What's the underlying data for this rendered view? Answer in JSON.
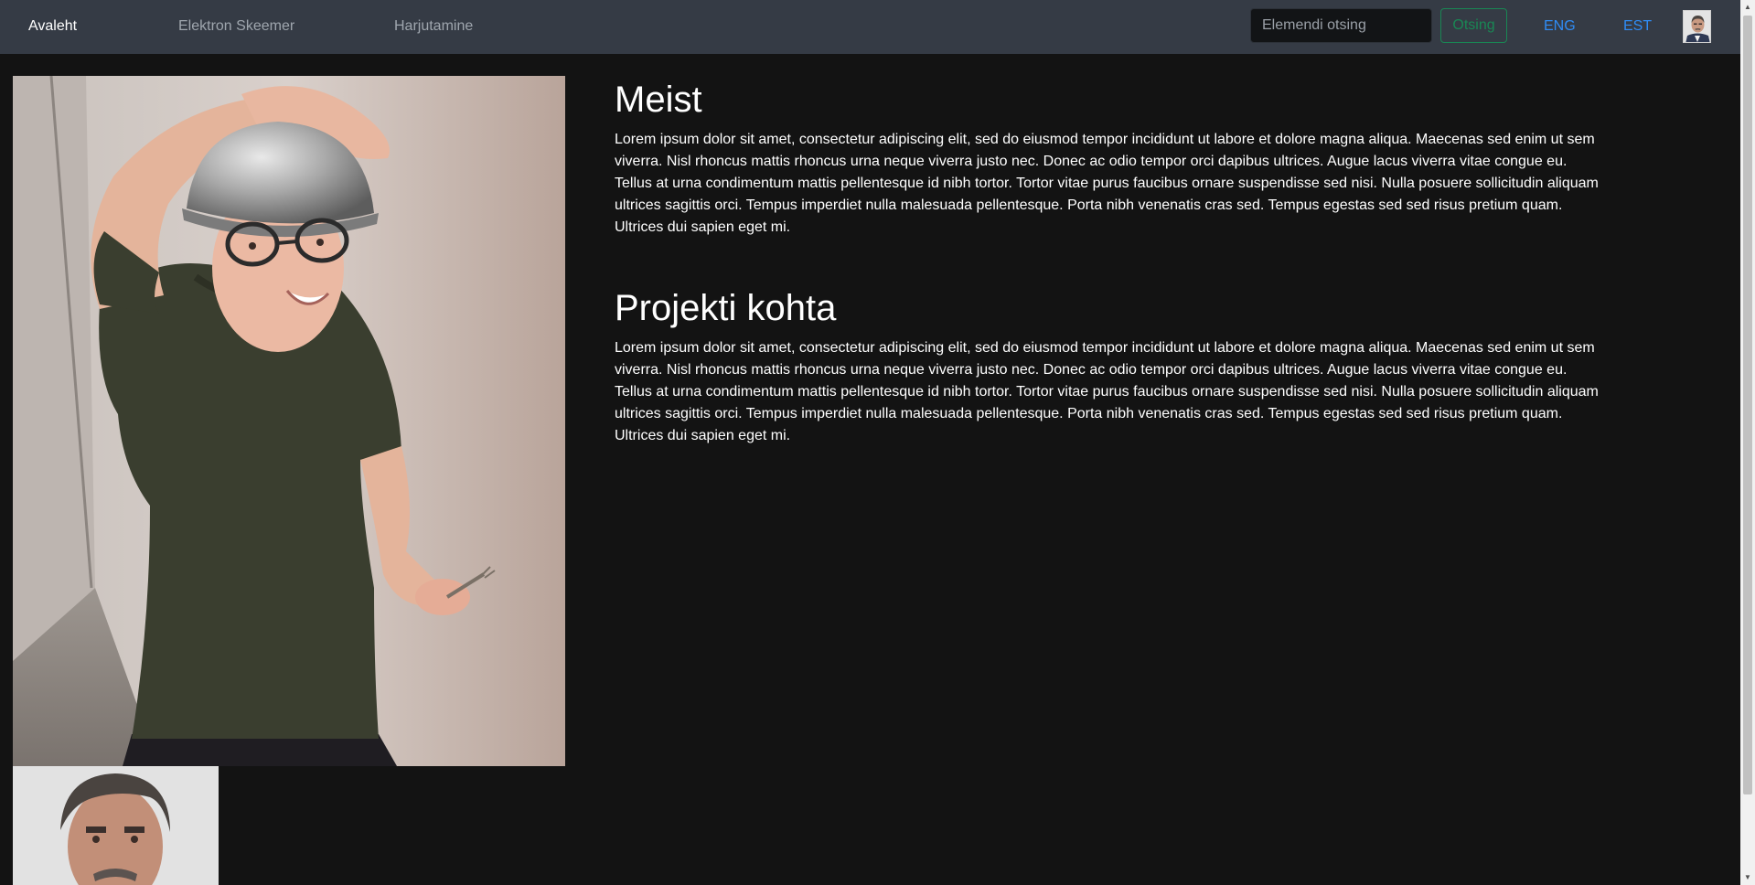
{
  "navbar": {
    "home": "Avaleht",
    "circuits": "Elektron Skeemer",
    "practice": "Harjutamine",
    "search_placeholder": "Elemendi otsing",
    "search_button": "Otsing",
    "lang_eng": "ENG",
    "lang_est": "EST",
    "avatar_icon": "user-photo-icon"
  },
  "sections": [
    {
      "title": "Meist",
      "text": "Lorem ipsum dolor sit amet, consectetur adipiscing elit, sed do eiusmod tempor incididunt ut labore et dolore magna aliqua. Maecenas sed enim ut sem viverra. Nisl rhoncus mattis rhoncus urna neque viverra justo nec. Donec ac odio tempor orci dapibus ultrices. Augue lacus viverra vitae congue eu. Tellus at urna condimentum mattis pellentesque id nibh tortor. Tortor vitae purus faucibus ornare suspendisse sed nisi. Nulla posuere sollicitudin aliquam ultrices sagittis orci. Tempus imperdiet nulla malesuada pellentesque. Porta nibh venenatis cras sed. Tempus egestas sed sed risus pretium quam. Ultrices dui sapien eget mi."
    },
    {
      "title": "Projekti kohta",
      "text": "Lorem ipsum dolor sit amet, consectetur adipiscing elit, sed do eiusmod tempor incididunt ut labore et dolore magna aliqua. Maecenas sed enim ut sem viverra. Nisl rhoncus mattis rhoncus urna neque viverra justo nec. Donec ac odio tempor orci dapibus ultrices. Augue lacus viverra vitae congue eu. Tellus at urna condimentum mattis pellentesque id nibh tortor. Tortor vitae purus faucibus ornare suspendisse sed nisi. Nulla posuere sollicitudin aliquam ultrices sagittis orci. Tempus imperdiet nulla malesuada pellentesque. Porta nibh venenatis cras sed. Tempus egestas sed sed risus pretium quam. Ultrices dui sapien eget mi."
    }
  ],
  "colors": {
    "navbar_bg": "#353b45",
    "page_bg": "#131313",
    "link_blue": "#2f8cf6",
    "success_green": "#198754"
  }
}
